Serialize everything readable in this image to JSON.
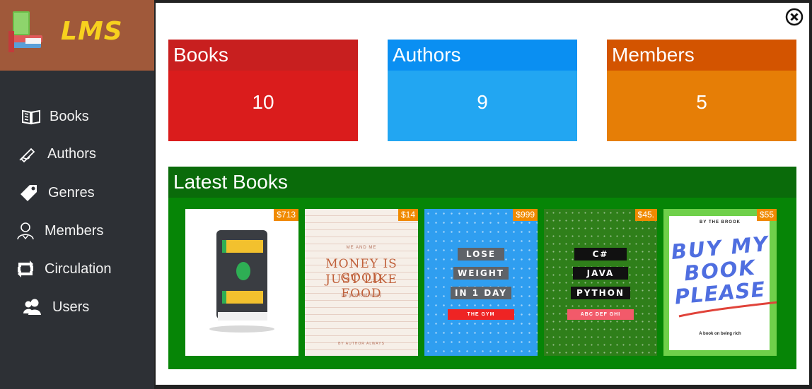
{
  "app": {
    "logo_text": "LMS"
  },
  "sidebar": {
    "items": [
      {
        "label": "Books",
        "icon": "book-open-icon"
      },
      {
        "label": "Authors",
        "icon": "pen-writing-icon"
      },
      {
        "label": "Genres",
        "icon": "tag-icon"
      },
      {
        "label": "Members",
        "icon": "member-person-icon"
      },
      {
        "label": "Circulation",
        "icon": "circulation-arrows-icon"
      },
      {
        "label": "Users",
        "icon": "users-icon"
      }
    ]
  },
  "stats": [
    {
      "label": "Books",
      "value": "10",
      "head_color": "#c81f1f",
      "body_color": "#da1c1c"
    },
    {
      "label": "Authors",
      "value": "9",
      "head_color": "#0a8ff2",
      "body_color": "#22a6f2"
    },
    {
      "label": "Members",
      "value": "5",
      "head_color": "#d35400",
      "body_color": "#e67e06"
    }
  ],
  "latest": {
    "title": "Latest Books",
    "books": [
      {
        "price": "$713"
      },
      {
        "price": "$14",
        "top": "ME AND ME",
        "title1": "MONEY IS GOOD",
        "title2": "JUST LIKE FOOD",
        "sub": "the good food money",
        "author": "BY AUTHOR ALWAYS"
      },
      {
        "price": "$999",
        "line1": "LOSE",
        "line2": "WEIGHT",
        "line3": "IN 1 DAY",
        "band": "THE GYM"
      },
      {
        "price": "$45.",
        "line1": "C#",
        "line2": "JAVA",
        "line3": "PYTHON",
        "band": "ABC DEF GHI"
      },
      {
        "price": "$55",
        "top": "BY THE BROOK",
        "title1": "BUY MY",
        "title2": "BOOK",
        "title3": "PLEASE",
        "sub": "A book on being rich"
      }
    ]
  },
  "colors": {
    "sidebar": "#2d3035",
    "logo_bg": "#a0593a",
    "latest_bg": "#068506"
  }
}
